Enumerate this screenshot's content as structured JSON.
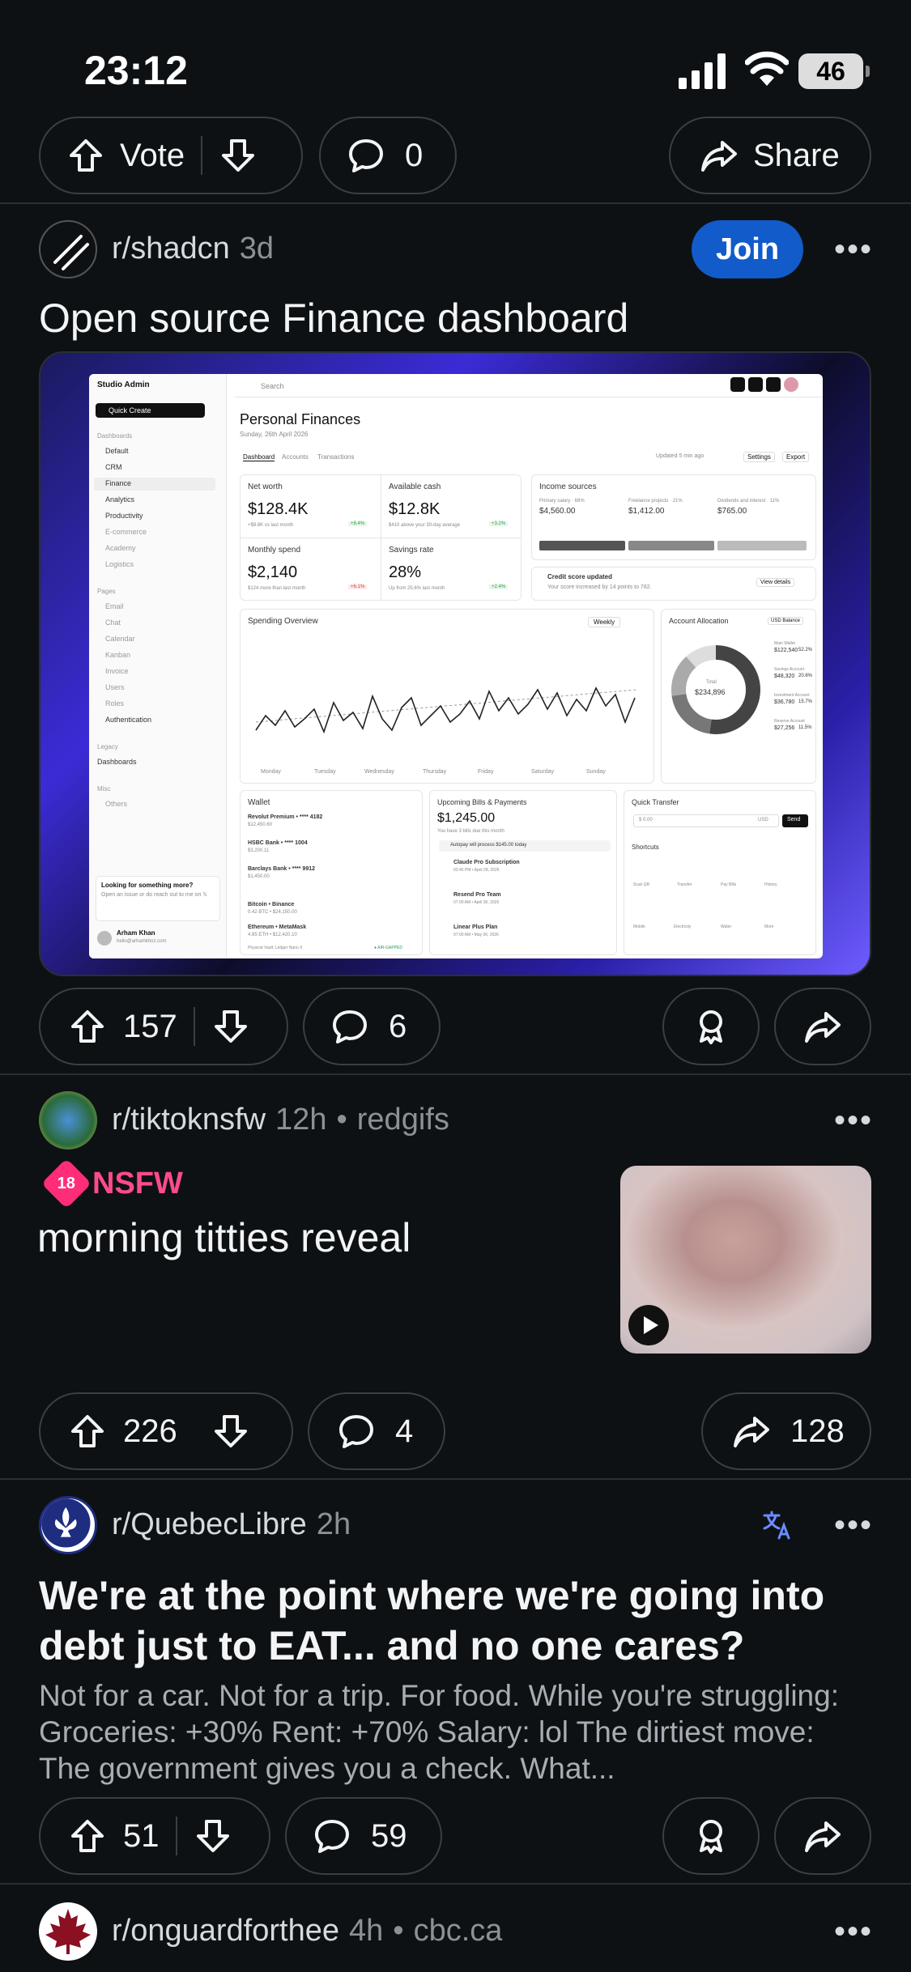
{
  "status_bar": {
    "time": "23:12",
    "battery": "46"
  },
  "post0": {
    "vote_label": "Vote",
    "comments": "0",
    "share_label": "Share"
  },
  "post1": {
    "subreddit": "r/shadcn",
    "age": "3d",
    "join_label": "Join",
    "title": "Open source Finance dashboard",
    "upvotes": "157",
    "comments": "6",
    "dashboard": {
      "brand": "Studio Admin",
      "quick_create": "Quick Create",
      "search": "Search",
      "page_title": "Personal Finances",
      "date": "Sunday, 26th April 2026",
      "tabs": [
        "Dashboard",
        "Accounts",
        "Transactions"
      ],
      "updated": "Updated 5 min ago",
      "settings": "Settings",
      "export": "Export",
      "sidebar_sections": [
        "Dashboards",
        "Pages",
        "Legacy",
        "Misc"
      ],
      "sidebar_items": [
        "Default",
        "CRM",
        "Finance",
        "Analytics",
        "Productivity",
        "E-commerce",
        "Academy",
        "Logistics",
        "Email",
        "Chat",
        "Calendar",
        "Kanban",
        "Invoice",
        "Users",
        "Roles",
        "Authentication",
        "Dashboards",
        "Others"
      ],
      "help_title": "Looking for something more?",
      "help_text": "Open an issue or do reach out to me on 𝕏",
      "user": "Arham Khan",
      "user_email": "hello@arhamkhnz.com",
      "kpis": [
        {
          "label": "Net worth",
          "value": "$128.4K",
          "note": "+$9.8K vs last month",
          "delta": "+8.4%"
        },
        {
          "label": "Available cash",
          "value": "$12.8K",
          "note": "$410 above your 30-day average",
          "delta": "+3.2%"
        },
        {
          "label": "Monthly spend",
          "value": "$2,140",
          "note": "$124 more than last month",
          "delta": "+6.1%"
        },
        {
          "label": "Savings rate",
          "value": "28%",
          "note": "Up from 25.6% last month",
          "delta": "+2.4%"
        }
      ],
      "income": {
        "title": "Income sources",
        "items": [
          {
            "label": "Primary salary · 68%",
            "value": "$4,560.00"
          },
          {
            "label": "Freelance projects · 21%",
            "value": "$1,412.00"
          },
          {
            "label": "Dividends and interest · 11%",
            "value": "$765.00"
          }
        ]
      },
      "credit": {
        "title": "Credit score updated",
        "text": "Your score increased by 14 points to 782.",
        "button": "View details"
      },
      "spending": {
        "title": "Spending Overview",
        "range": "Weekly",
        "days": [
          "Monday",
          "Tuesday",
          "Wednesday",
          "Thursday",
          "Friday",
          "Saturday",
          "Sunday"
        ]
      },
      "allocation": {
        "title": "Account Allocation",
        "currency": "USD Balance",
        "total_label": "Total",
        "total": "$234,896",
        "items": [
          {
            "label": "Main Wallet",
            "value": "$122,540",
            "pct": "52.2%"
          },
          {
            "label": "Savings Account",
            "value": "$48,320",
            "pct": "20.6%"
          },
          {
            "label": "Investment Account",
            "value": "$36,780",
            "pct": "15.7%"
          },
          {
            "label": "Reserve Account",
            "value": "$27,256",
            "pct": "11.5%"
          }
        ]
      },
      "wallet": {
        "title": "Wallet",
        "items": [
          {
            "name": "Revolut Premium • **** 4182",
            "amount": "$12,450.60"
          },
          {
            "name": "HSBC Bank • **** 1004",
            "amount": "$3,200.11"
          },
          {
            "name": "Barclays Bank • **** 9912",
            "amount": "$1,450.00"
          },
          {
            "name": "Bitcoin • Binance",
            "amount": "0.42 BTC • $24,150.00"
          },
          {
            "name": "Ethereum • MetaMask",
            "amount": "4.85 ETH • $12,420.10"
          }
        ],
        "footer": "Physical Vault: Ledger Nano X",
        "footer_tag": "● AIR-GAPPED"
      },
      "bills": {
        "title": "Upcoming Bills & Payments",
        "total": "$1,245.00",
        "note": "You have 3 bills due this month",
        "autopay": "Autopay will process $145.00 today",
        "items": [
          {
            "name": "Claude Pro Subscription",
            "time": "02:45 PM • April 28, 2026"
          },
          {
            "name": "Resend Pro Team",
            "time": "07:00 AM • April 30, 2026"
          },
          {
            "name": "Linear Plus Plan",
            "time": "07:00 AM • May 06, 2026"
          }
        ]
      },
      "transfer": {
        "title": "Quick Transfer",
        "amount": "$ 0.00",
        "currency": "USD",
        "send": "Send"
      },
      "shortcuts": {
        "title": "Shortcuts",
        "items": [
          "Scan QR",
          "Transfer",
          "Pay Bills",
          "History",
          "Mobile",
          "Electricity",
          "Water",
          "More"
        ]
      }
    }
  },
  "post2": {
    "subreddit": "r/tiktoknsfw",
    "age": "12h",
    "domain": "redgifs",
    "nsfw_badge": "18",
    "nsfw_label": "NSFW",
    "title": "morning titties reveal",
    "upvotes": "226",
    "comments": "4",
    "shares": "128"
  },
  "post3": {
    "subreddit": "r/QuebecLibre",
    "age": "2h",
    "title": "We're at the point where we're going into debt just to EAT... and no one cares?",
    "body": "Not for a car. Not for a trip. For food. While you're struggling: Groceries: +30% Rent: +70% Salary: lol The dirtiest move: The government gives you a check. What...",
    "upvotes": "51",
    "comments": "59"
  },
  "post4": {
    "subreddit": "r/onguardforthee",
    "age": "4h",
    "domain": "cbc.ca"
  }
}
